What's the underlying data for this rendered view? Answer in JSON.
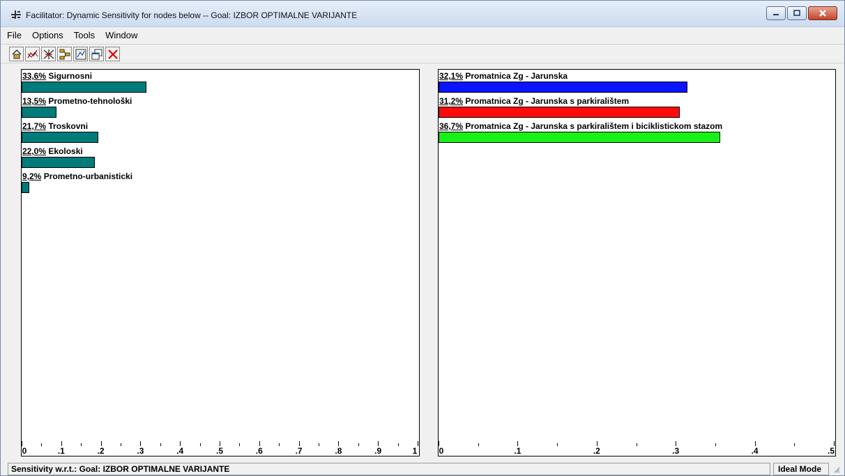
{
  "window": {
    "title": "Facilitator: Dynamic Sensitivity for nodes below -- Goal: IZBOR OPTIMALNE VARIJANTE",
    "controls": [
      "minimize",
      "maximize",
      "close"
    ]
  },
  "menu": [
    "File",
    "Options",
    "Tools",
    "Window"
  ],
  "toolbar": {
    "icons": [
      "home-icon",
      "graph-icon",
      "scissors-icon",
      "tree-icon",
      "gradient-icon",
      "windows-icon",
      "close-x-icon"
    ]
  },
  "chart_data": [
    {
      "type": "bar",
      "orientation": "horizontal",
      "categories": [
        "Sigurnosni",
        "Prometno-tehnološki",
        "Troskovni",
        "Ekoloski",
        "Prometno-urbanisticki"
      ],
      "pct_labels": [
        "33,6%",
        "13,5%",
        "21,7%",
        "22,0%",
        "9,2%"
      ],
      "values": [
        0.316,
        0.088,
        0.193,
        0.184,
        0.02
      ],
      "bar_color": "#007b7b",
      "xlim": [
        0,
        1
      ],
      "ticks": [
        "0",
        ".1",
        ".2",
        ".3",
        ".4",
        ".5",
        ".6",
        ".7",
        ".8",
        ".9",
        "1"
      ]
    },
    {
      "type": "bar",
      "orientation": "horizontal",
      "categories": [
        "Promatnica Zg - Jarunska",
        "Promatnica Zg - Jarunska s parkiralištem",
        "Promatnica Zg - Jarunska s parkiralištem i biciklistickom stazom"
      ],
      "pct_labels": [
        "32,1%",
        "31,2%",
        "36,7%"
      ],
      "values": [
        0.315,
        0.305,
        0.356
      ],
      "colors": [
        "#0a14ff",
        "#ff0b0b",
        "#19f019"
      ],
      "xlim": [
        0,
        0.5
      ],
      "ticks": [
        "0",
        ".1",
        ".2",
        ".3",
        ".4",
        ".5"
      ]
    }
  ],
  "status": {
    "left": "Sensitivity w.r.t.: Goal: IZBOR OPTIMALNE VARIJANTE",
    "right": "Ideal Mode"
  }
}
